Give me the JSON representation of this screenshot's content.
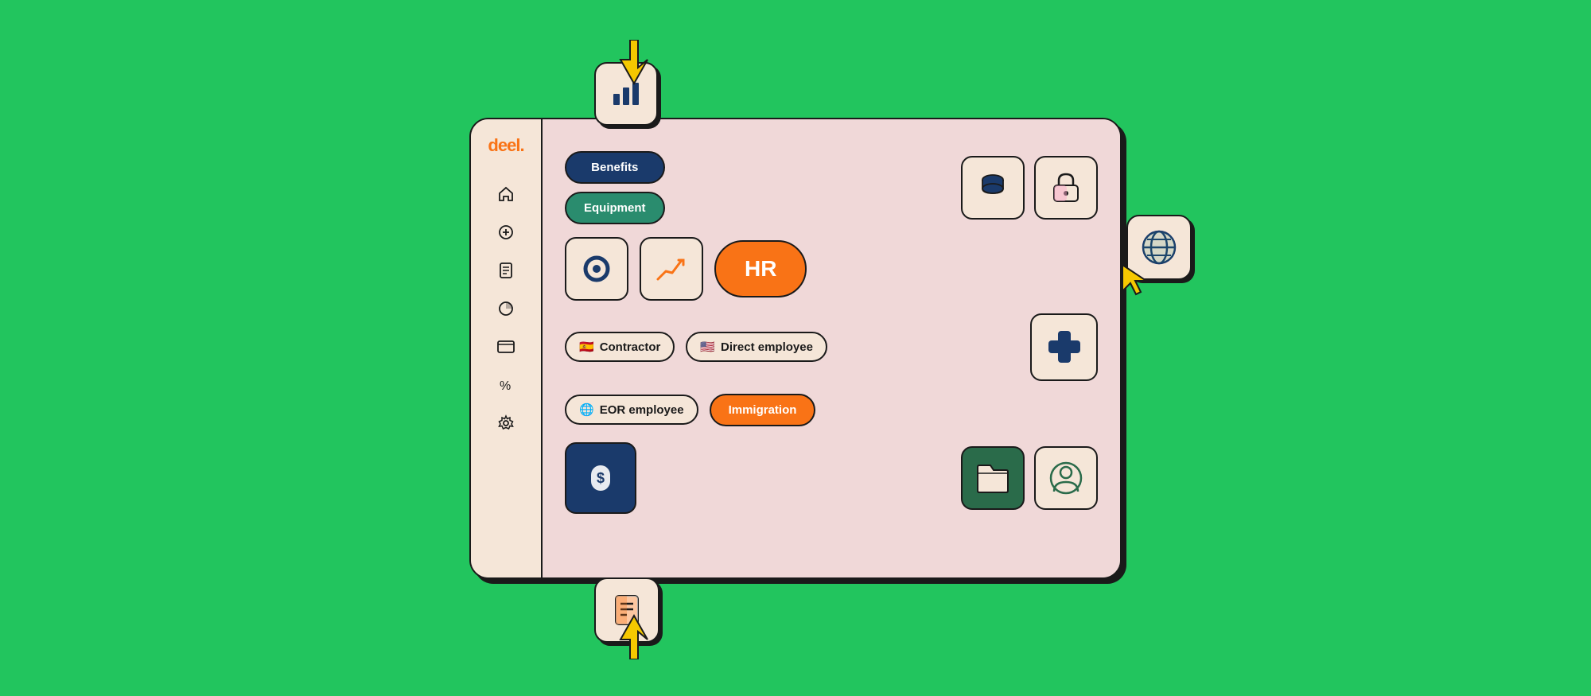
{
  "brand": {
    "logo_text": "deel",
    "logo_dot_color": "#f97316"
  },
  "sidebar": {
    "icons": [
      {
        "name": "home-icon",
        "symbol": "⌂",
        "interactable": true
      },
      {
        "name": "add-icon",
        "symbol": "⊕",
        "interactable": true
      },
      {
        "name": "document-icon",
        "symbol": "▤",
        "interactable": true
      },
      {
        "name": "chart-icon",
        "symbol": "◔",
        "interactable": true
      },
      {
        "name": "card-icon",
        "symbol": "▬",
        "interactable": true
      },
      {
        "name": "percent-icon",
        "symbol": "%",
        "interactable": true
      },
      {
        "name": "settings-icon",
        "symbol": "⚙",
        "interactable": true
      }
    ]
  },
  "content": {
    "row1": {
      "pills": [
        {
          "label": "Benefits",
          "style": "blue-dark"
        },
        {
          "label": "Equipment",
          "style": "teal"
        }
      ],
      "cards": [
        {
          "name": "database-card",
          "type": "icon"
        },
        {
          "name": "lock-card",
          "type": "icon"
        }
      ]
    },
    "row2": {
      "cards": [
        {
          "name": "circle-card",
          "type": "icon"
        },
        {
          "name": "chart-card",
          "type": "icon"
        }
      ],
      "hr_label": "HR"
    },
    "row3": {
      "pills": [
        {
          "label": "Contractor",
          "style": "outline",
          "flag": "🇪🇸"
        },
        {
          "label": "Direct employee",
          "style": "outline",
          "flag": "🇺🇸"
        }
      ],
      "cards": [
        {
          "name": "medical-cross-card",
          "type": "icon"
        }
      ]
    },
    "row4": {
      "pills": [
        {
          "label": "EOR employee",
          "style": "outline",
          "flag": "🌐"
        },
        {
          "label": "Immigration",
          "style": "orange"
        }
      ]
    },
    "row5": {
      "cards": [
        {
          "name": "dollar-card",
          "style": "blue"
        },
        {
          "name": "folder-card",
          "style": "green"
        },
        {
          "name": "person-card",
          "style": "cream"
        }
      ]
    }
  },
  "floating": {
    "top": {
      "name": "bar-chart-floating",
      "label": "bar chart icon"
    },
    "bottom": {
      "name": "document-floating",
      "label": "document icon"
    },
    "right": {
      "name": "globe-floating",
      "label": "globe icon"
    }
  },
  "colors": {
    "bg": "#22c55e",
    "card_bg": "#f5e6d8",
    "content_bg": "#f0d8d8",
    "dark_blue": "#1a3a6b",
    "teal": "#2a8c6e",
    "orange": "#f97316",
    "dark_green": "#2a6b4a",
    "border": "#1a1a1a",
    "yellow_arrow": "#f5c800"
  }
}
